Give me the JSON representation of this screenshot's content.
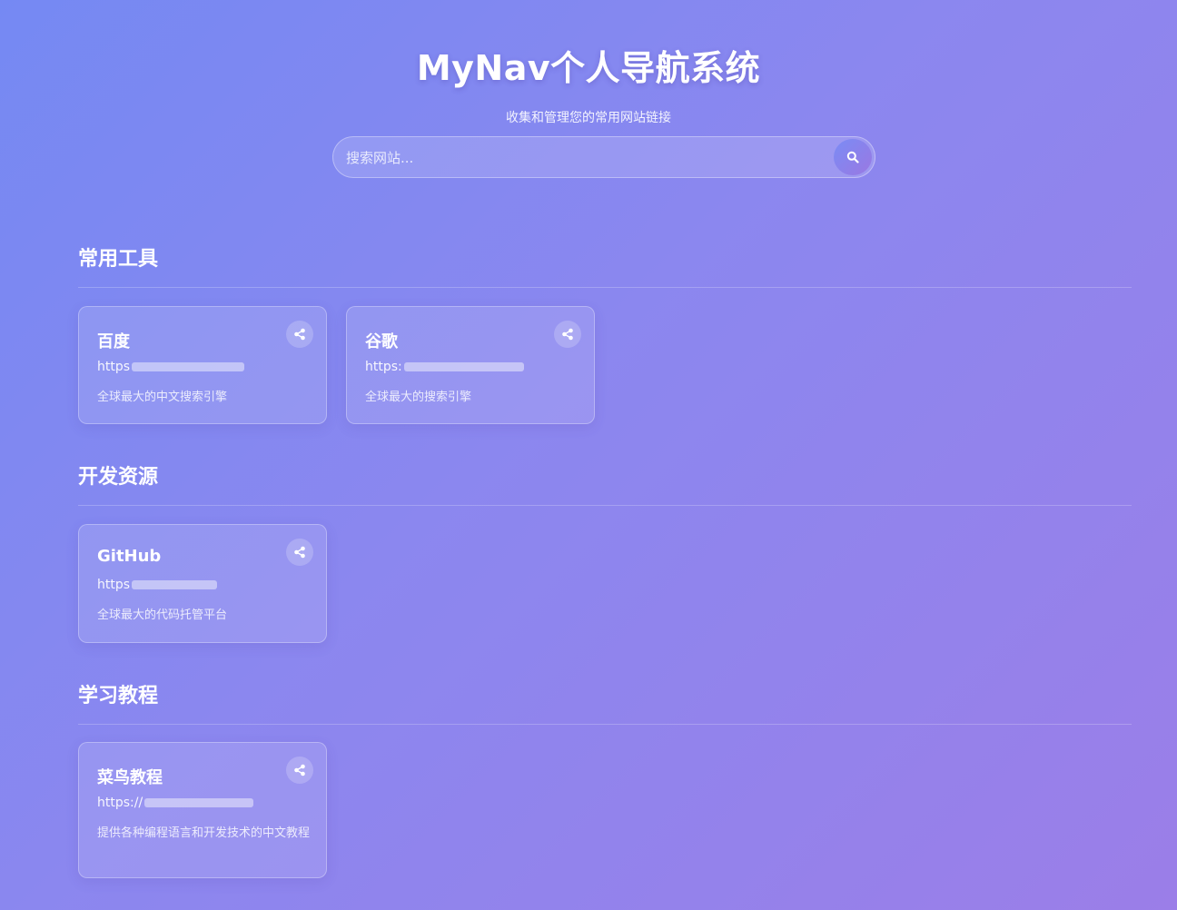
{
  "header": {
    "title": "MyNav个人导航系统",
    "subtitle": "收集和管理您的常用网站链接"
  },
  "search": {
    "placeholder": "搜索网站...",
    "value": "",
    "button_icon": "search-icon"
  },
  "sections": [
    {
      "title": "常用工具",
      "cards": [
        {
          "name": "百度",
          "url_prefix": "https",
          "description": "全球最大的中文搜索引擎",
          "share_icon": "share-icon"
        },
        {
          "name": "谷歌",
          "url_prefix": "https:",
          "description": "全球最大的搜索引擎",
          "share_icon": "share-icon"
        }
      ]
    },
    {
      "title": "开发资源",
      "cards": [
        {
          "name": "GitHub",
          "url_prefix": "https",
          "description": "全球最大的代码托管平台",
          "share_icon": "share-icon"
        }
      ]
    },
    {
      "title": "学习教程",
      "cards": [
        {
          "name": "菜鸟教程",
          "url_prefix": "https://",
          "description": "提供各种编程语言和开发技术的中文教程",
          "share_icon": "share-icon"
        }
      ]
    }
  ],
  "colors": {
    "background_start": "#7589f3",
    "background_end": "#9b7ee8",
    "text": "#ffffff"
  }
}
